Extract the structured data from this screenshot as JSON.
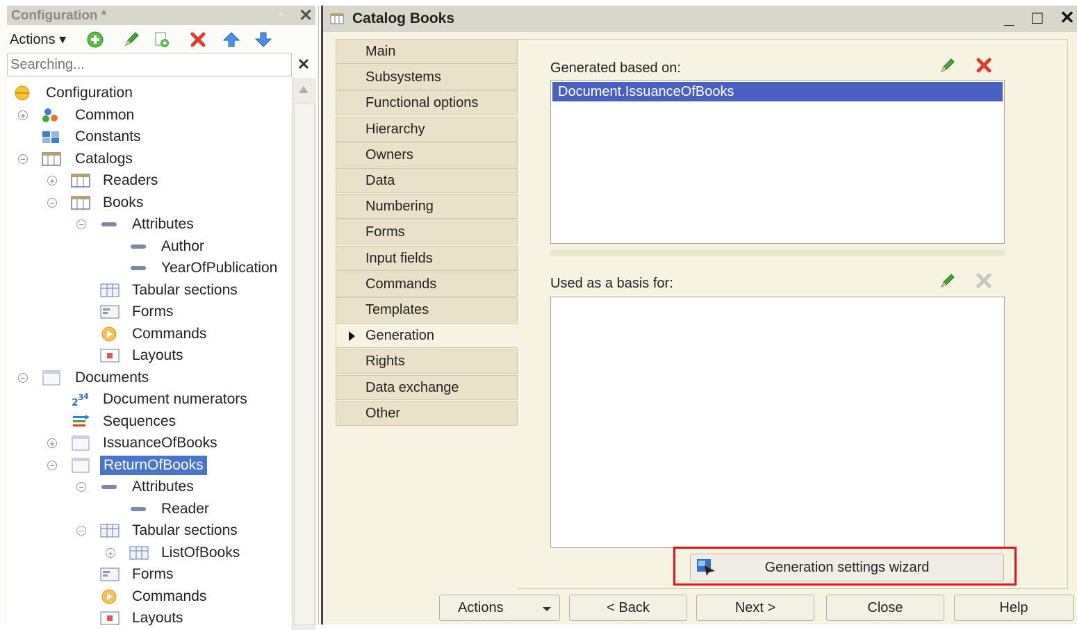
{
  "configuration_panel": {
    "title": "Configuration *",
    "actions_label": "Actions ▾",
    "search_placeholder": "Searching...",
    "tree": [
      {
        "label": "Configuration"
      },
      {
        "label": "Common"
      },
      {
        "label": "Constants"
      },
      {
        "label": "Catalogs"
      },
      {
        "label": "Readers"
      },
      {
        "label": "Books"
      },
      {
        "label": "Attributes"
      },
      {
        "label": "Author"
      },
      {
        "label": "YearOfPublication"
      },
      {
        "label": "Tabular sections"
      },
      {
        "label": "Forms"
      },
      {
        "label": "Commands"
      },
      {
        "label": "Layouts"
      },
      {
        "label": "Documents"
      },
      {
        "label": "Document numerators"
      },
      {
        "label": "Sequences"
      },
      {
        "label": "IssuanceOfBooks"
      },
      {
        "label": "ReturnOfBooks"
      },
      {
        "label": "Attributes"
      },
      {
        "label": "Reader"
      },
      {
        "label": "Tabular sections"
      },
      {
        "label": "ListOfBooks"
      },
      {
        "label": "Forms"
      },
      {
        "label": "Commands"
      },
      {
        "label": "Layouts"
      }
    ]
  },
  "catalog_window": {
    "title": "Catalog Books",
    "minimize": "_",
    "maximize": "□",
    "close": "✕",
    "tabs": [
      {
        "label": "Main"
      },
      {
        "label": "Subsystems"
      },
      {
        "label": "Functional options"
      },
      {
        "label": "Hierarchy"
      },
      {
        "label": "Owners"
      },
      {
        "label": "Data"
      },
      {
        "label": "Numbering"
      },
      {
        "label": "Forms"
      },
      {
        "label": "Input fields"
      },
      {
        "label": "Commands"
      },
      {
        "label": "Templates"
      },
      {
        "label": "Generation"
      },
      {
        "label": "Rights"
      },
      {
        "label": "Data exchange"
      },
      {
        "label": "Other"
      }
    ],
    "active_tab": "Generation",
    "generated_based_on_label": "Generated based on:",
    "generated_based_on_items": [
      "Document.IssuanceOfBooks"
    ],
    "used_as_basis_label": "Used as a basis for:",
    "wizard_button": "Generation settings wizard",
    "buttons": {
      "actions": "Actions",
      "back": "< Back",
      "next": "Next >",
      "close": "Close",
      "help": "Help"
    }
  },
  "colors": {
    "selection": "#4a5fc2",
    "highlight_frame": "#e8101a",
    "tab_background": "#e9e1c8",
    "window_background": "#f7f3e3"
  }
}
